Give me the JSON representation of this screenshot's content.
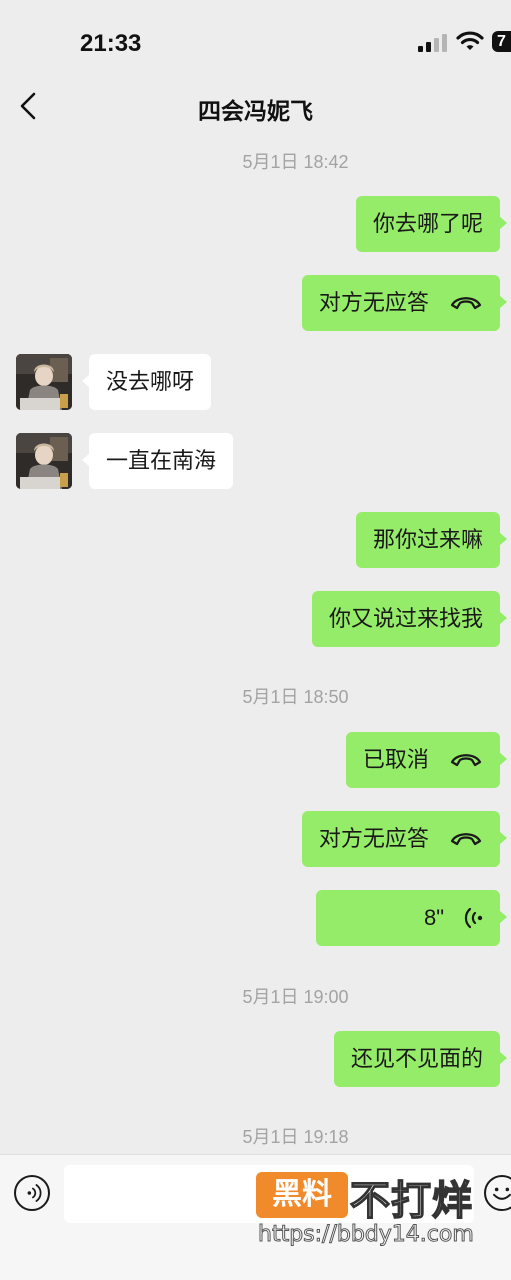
{
  "status_bar": {
    "time": "21:33",
    "battery": "7"
  },
  "header": {
    "title": "四会冯妮飞"
  },
  "messages": {
    "ts1": "5月1日 18:42",
    "m1": "你去哪了呢",
    "m2": "对方无应答",
    "m3": "没去哪呀",
    "m4": "一直在南海",
    "m5": "那你过来嘛",
    "m6": "你又说过来找我",
    "ts2": "5月1日 18:50",
    "m7": "已取消",
    "m8": "对方无应答",
    "m9_duration": "8\"",
    "ts3": "5月1日 19:00",
    "m10": "还见不见面的",
    "ts4": "5月1日 19:18"
  },
  "input": {
    "placeholder": ""
  },
  "watermark": {
    "badge": "黑料",
    "text": "不打烊",
    "url": "https://bbdy14.com"
  },
  "colors": {
    "sent_bubble": "#95ec69",
    "received_bubble": "#ffffff",
    "background": "#ededed",
    "timestamp": "#a3a3a3"
  },
  "icons": [
    "back-icon",
    "phone-hangup-icon",
    "voice-wave-icon",
    "voice-input-icon",
    "emoji-icon",
    "signal-icon",
    "wifi-icon",
    "battery-icon"
  ]
}
